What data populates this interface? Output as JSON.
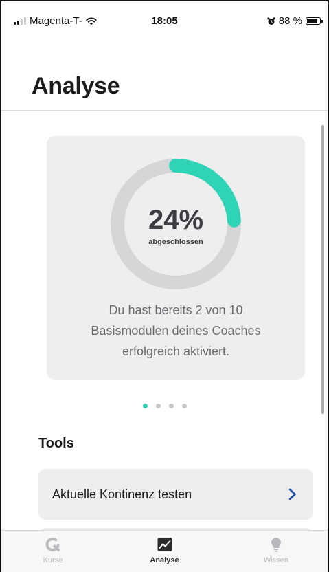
{
  "status_bar": {
    "carrier": "Magenta-T-",
    "time": "18:05",
    "battery_text": "88 %",
    "battery_level": 0.88,
    "signal_bars": 2
  },
  "header": {
    "title": "Analyse"
  },
  "progress_card": {
    "progress": 0.24,
    "percent_text": "24%",
    "caption": "abgeschlossen",
    "message_lines": [
      "Du hast bereits 2 von 10",
      "Basismodulen deines Coaches",
      "erfolgreich aktiviert."
    ],
    "ring_color": "#2fd3b6",
    "track_color": "#d6d6d9"
  },
  "pager": {
    "count": 4,
    "active_index": 0
  },
  "tools": {
    "title": "Tools",
    "items": [
      {
        "label": "Aktuelle Kontinenz testen",
        "icon": "chevron-right-icon"
      }
    ]
  },
  "tab_bar": {
    "tabs": [
      {
        "label": "Kurse",
        "icon": "kurse-icon",
        "active": false
      },
      {
        "label": "Analyse",
        "icon": "chart-icon",
        "active": true
      },
      {
        "label": "Wissen",
        "icon": "lightbulb-icon",
        "active": false
      }
    ]
  },
  "colors": {
    "accent": "#2fd3b6",
    "chevron": "#1f4fa8"
  }
}
